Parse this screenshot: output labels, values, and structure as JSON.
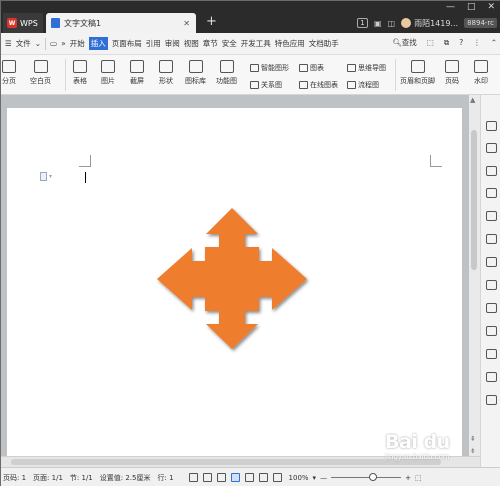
{
  "app": {
    "tab_wps": "WPS",
    "doc_tab": "文字文稿1",
    "new_tab": "+",
    "user": "雨陌1419...",
    "version": "8894-rc",
    "badge": "1"
  },
  "window": {
    "min": "—",
    "restore": "□",
    "close": "✕"
  },
  "menubar": {
    "file": "文件",
    "more": "»",
    "items": [
      "开始",
      "插入",
      "页面布局",
      "引用",
      "审阅",
      "视图",
      "章节",
      "安全",
      "开发工具",
      "特色应用",
      "文档助手"
    ],
    "active_index": 1,
    "search": "查找",
    "help": "?"
  },
  "ribbon": {
    "large": [
      "分页",
      "空白页",
      "表格",
      "图片",
      "截屏",
      "形状",
      "图标库",
      "功能图",
      "页眉和页脚",
      "页码",
      "水印"
    ],
    "small": [
      "智能图形",
      "图表",
      "思维导图",
      "关系图",
      "在线图表",
      "流程图"
    ]
  },
  "shape": {
    "color": "#ef7d2f",
    "icon": "four-way-arrow"
  },
  "status": {
    "page_num": "页码: 1",
    "pages": "页面: 1/1",
    "section": "节: 1/1",
    "setting": "设置值: 2.5厘米",
    "row": "行: 1",
    "zoom": "100%",
    "zoom_minus": "—",
    "zoom_plus": "+"
  },
  "watermark": {
    "text": "Bai du",
    "sub": "jingyan.baidu.com"
  }
}
